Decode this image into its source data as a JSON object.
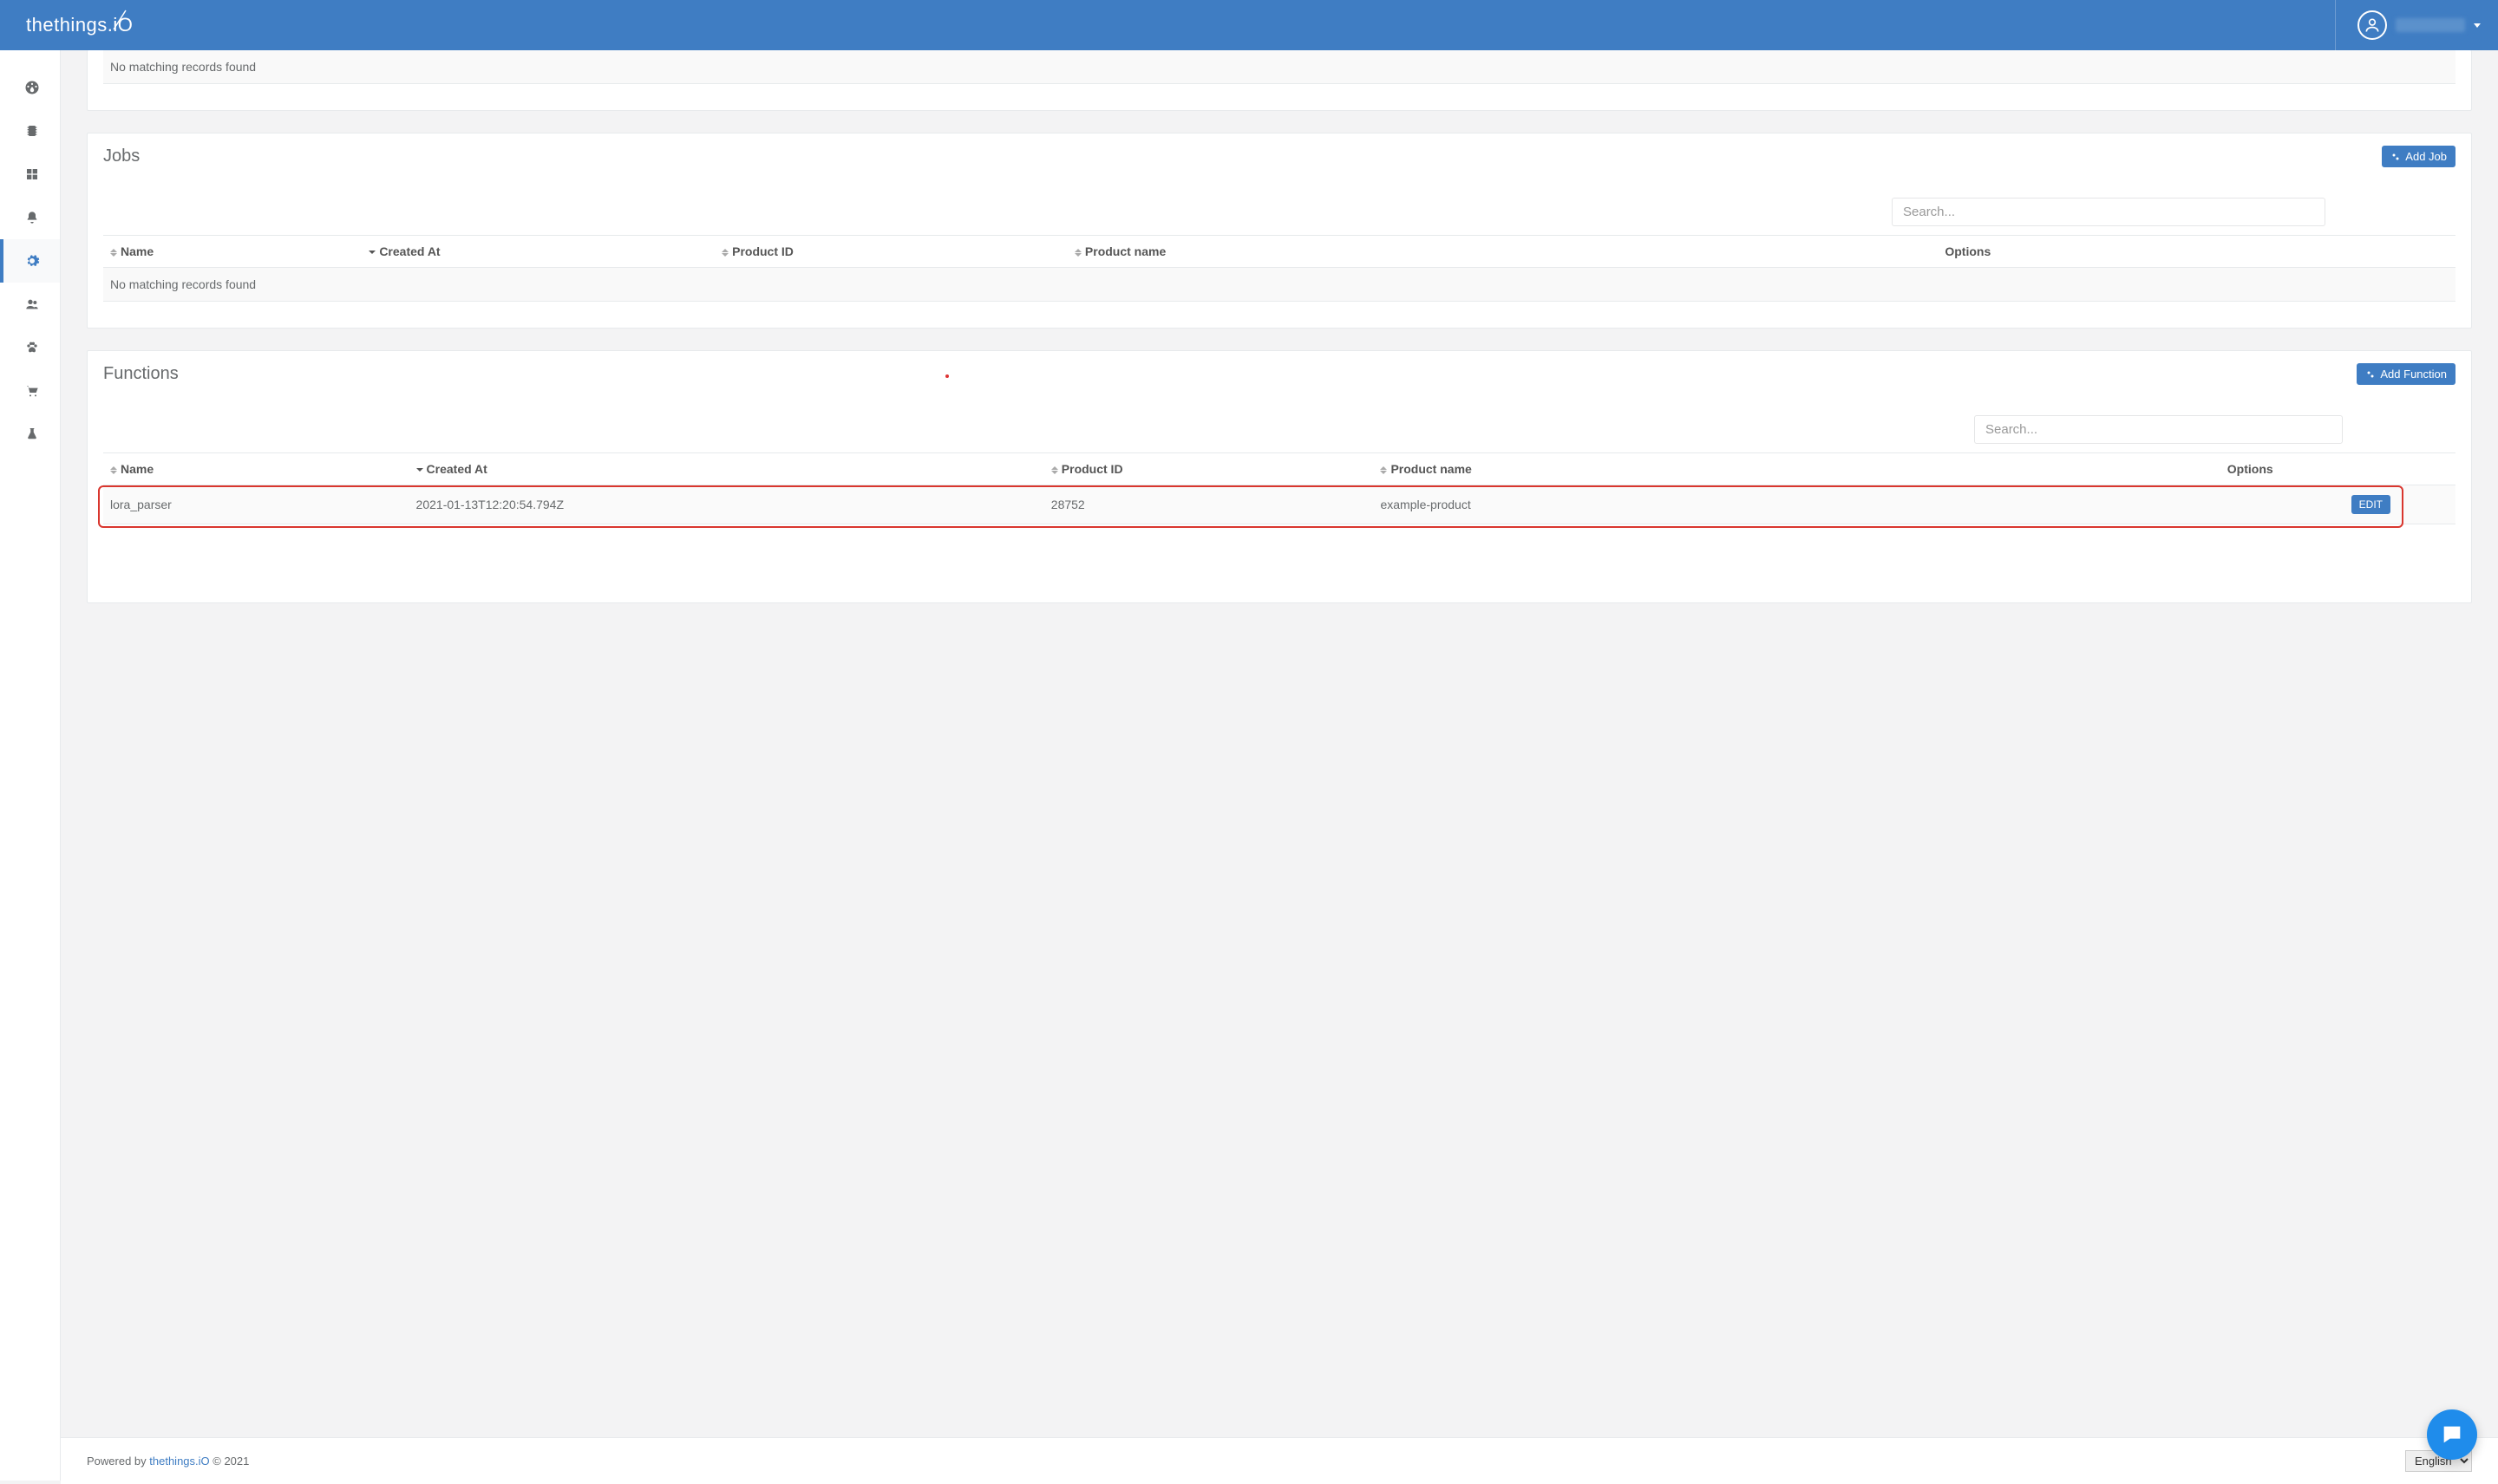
{
  "header": {
    "logo_text": "thethings",
    "logo_suffix": ".iO"
  },
  "top_panel": {
    "empty_msg": "No matching records found"
  },
  "jobs_panel": {
    "title": "Jobs",
    "add_label": "Add Job",
    "search_placeholder": "Search...",
    "columns": {
      "name": "Name",
      "created_at": "Created At",
      "product_id": "Product ID",
      "product_name": "Product name",
      "options": "Options"
    },
    "empty_msg": "No matching records found"
  },
  "functions_panel": {
    "title": "Functions",
    "add_label": "Add Function",
    "search_placeholder": "Search...",
    "columns": {
      "name": "Name",
      "created_at": "Created At",
      "product_id": "Product ID",
      "product_name": "Product name",
      "options": "Options"
    },
    "row": {
      "name": "lora_parser",
      "created_at": "2021-01-13T12:20:54.794Z",
      "product_id": "28752",
      "product_name": "example-product",
      "edit_label": "EDIT"
    }
  },
  "footer": {
    "prefix": "Powered by ",
    "link": "thethings.iO",
    "suffix": " © 2021",
    "language": "English"
  }
}
